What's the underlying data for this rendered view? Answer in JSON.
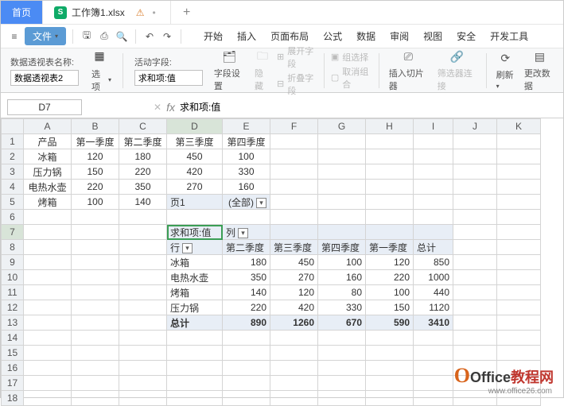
{
  "tabs": {
    "home": "首页",
    "doc": "工作簿1.xlsx",
    "add": "+"
  },
  "menu": {
    "file": "文件",
    "items": [
      "开始",
      "插入",
      "页面布局",
      "公式",
      "数据",
      "审阅",
      "视图",
      "安全",
      "开发工具"
    ]
  },
  "ribbon": {
    "pvNameLabel": "数据透视表名称:",
    "pvName": "数据透视表2",
    "options": "选项",
    "activeFieldLabel": "活动字段:",
    "activeField": "求和项:值",
    "fieldSettings": "字段设置",
    "hide": "隐藏",
    "expandField": "展开字段",
    "collapseField": "折叠字段",
    "groupSel": "组选择",
    "ungroup": "取消组合",
    "insertSlicer": "插入切片器",
    "slicerConn": "筛选器连接",
    "refresh": "刷新",
    "changeData": "更改数据"
  },
  "fbar": {
    "name": "D7",
    "fx": "fx",
    "formula": "求和项:值"
  },
  "cols": [
    "A",
    "B",
    "C",
    "D",
    "E",
    "F",
    "G",
    "H",
    "I",
    "J",
    "K"
  ],
  "rows": [
    "1",
    "2",
    "3",
    "4",
    "5",
    "6",
    "7",
    "8",
    "9",
    "10",
    "11",
    "12",
    "13",
    "14",
    "15",
    "16",
    "17",
    "18"
  ],
  "src": {
    "hdr": [
      "产品",
      "第一季度",
      "第二季度",
      "第三季度",
      "第四季度"
    ],
    "r2": [
      "冰箱",
      "120",
      "180",
      "450",
      "100"
    ],
    "r3": [
      "压力锅",
      "150",
      "220",
      "420",
      "330"
    ],
    "r4": [
      "电热水壶",
      "220",
      "350",
      "270",
      "160"
    ],
    "r5": [
      "烤箱",
      "100",
      "140"
    ],
    "page1": "页1",
    "all": "(全部)"
  },
  "pv": {
    "valLabel": "求和项:值",
    "colLabel": "列",
    "rowLabel": "行",
    "cols": [
      "第二季度",
      "第三季度",
      "第四季度",
      "第一季度",
      "总计"
    ],
    "rows": [
      {
        "n": "冰箱",
        "v": [
          "180",
          "450",
          "100",
          "120",
          "850"
        ]
      },
      {
        "n": "电热水壶",
        "v": [
          "350",
          "270",
          "160",
          "220",
          "1000"
        ]
      },
      {
        "n": "烤箱",
        "v": [
          "140",
          "120",
          "80",
          "100",
          "440"
        ]
      },
      {
        "n": "压力锅",
        "v": [
          "220",
          "420",
          "330",
          "150",
          "1120"
        ]
      }
    ],
    "total": {
      "n": "总计",
      "v": [
        "890",
        "1260",
        "670",
        "590",
        "3410"
      ]
    }
  },
  "wm": {
    "brand": "Office",
    "suffix": "教程网",
    "url": "www.office26.com"
  }
}
